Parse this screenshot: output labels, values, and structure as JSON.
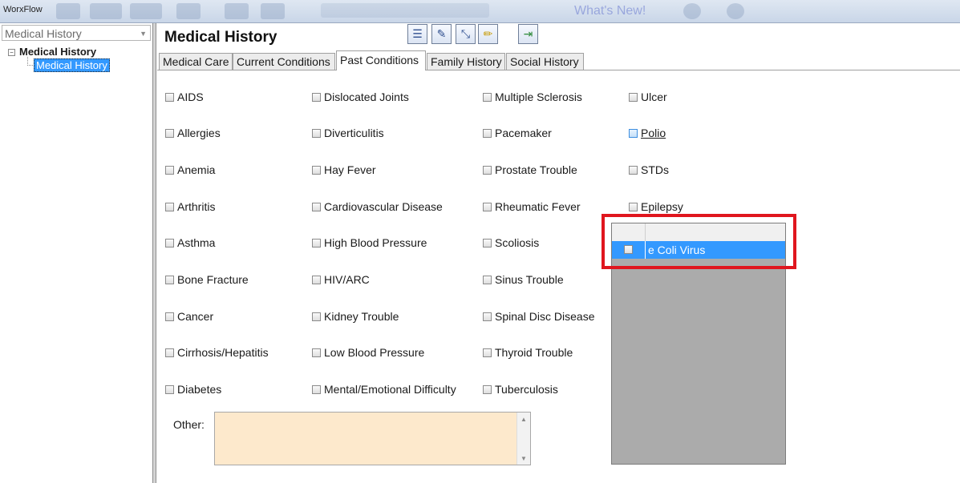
{
  "app": {
    "title": "WorxFlow"
  },
  "topbar": {
    "link": "What's New!"
  },
  "left": {
    "combo_value": "Medical History",
    "tree_root": "Medical History",
    "tree_child": "Medical History"
  },
  "main": {
    "title": "Medical History"
  },
  "tabs": [
    "Medical Care",
    "Current Conditions",
    "Past Conditions",
    "Family History",
    "Social History"
  ],
  "conditions": {
    "col1": [
      "AIDS",
      "Allergies",
      "Anemia",
      "Arthritis",
      "Asthma",
      "Bone Fracture",
      "Cancer",
      "Cirrhosis/Hepatitis",
      "Diabetes"
    ],
    "col2": [
      "Dislocated Joints",
      "Diverticulitis",
      "Hay Fever",
      "Cardiovascular Disease",
      "High Blood Pressure",
      "HIV/ARC",
      "Kidney Trouble",
      "Low Blood Pressure",
      "Mental/Emotional Difficulty"
    ],
    "col3": [
      "Multiple Sclerosis",
      "Pacemaker",
      "Prostate Trouble",
      "Rheumatic Fever",
      "Scoliosis",
      "Sinus Trouble",
      "Spinal Disc Disease",
      "Thyroid Trouble",
      "Tuberculosis"
    ],
    "col4": [
      "Ulcer",
      "Polio",
      "STDs",
      "Epilepsy"
    ]
  },
  "other": {
    "label": "Other:",
    "value": ""
  },
  "grid": {
    "rows": [
      "e Coli Virus"
    ]
  },
  "icons": [
    "chevron-down-icon",
    "tree-collapse-icon",
    "list-icon",
    "edit-icon",
    "chart-icon",
    "pencil-icon",
    "exit-icon",
    "scroll-up-icon",
    "scroll-down-icon"
  ],
  "colors": {
    "selection": "#3399ff",
    "highlight_box": "#e0161e",
    "other_field": "#fde9cc"
  }
}
